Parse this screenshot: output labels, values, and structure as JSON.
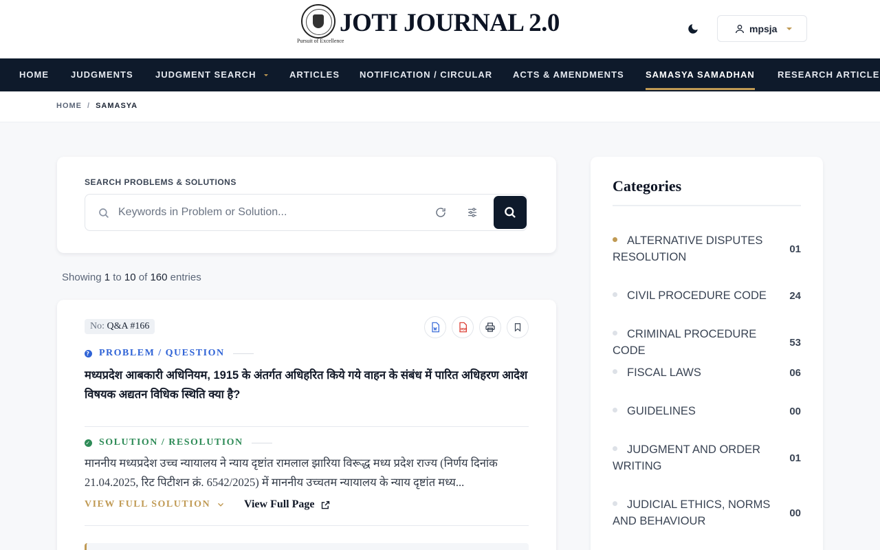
{
  "header": {
    "title": "JOTI JOURNAL 2.0",
    "motto": "Pursuit of Excellence",
    "user": "mpsja",
    "theme_icon": "moon-icon"
  },
  "nav": {
    "items": [
      {
        "label": "HOME"
      },
      {
        "label": "JUDGMENTS"
      },
      {
        "label": "JUDGMENT SEARCH"
      },
      {
        "label": "ARTICLES"
      },
      {
        "label": "NOTIFICATION / CIRCULAR"
      },
      {
        "label": "ACTS & AMENDMENTS"
      },
      {
        "label": "SAMASYA SAMADHAN"
      },
      {
        "label": "RESEARCH ARTICLES"
      }
    ],
    "active": "SAMASYA SAMADHAN"
  },
  "breadcrumb": {
    "home": "HOME",
    "sep": "/",
    "current": "SAMASYA"
  },
  "search": {
    "label": "SEARCH PROBLEMS & SOLUTIONS",
    "placeholder": "Keywords in Problem or Solution...",
    "value": ""
  },
  "entries": {
    "prefix": "Showing",
    "from": "1",
    "to_word": "to",
    "to": "10",
    "of_word": "of",
    "total": "160",
    "suffix": "entries"
  },
  "qa": {
    "no_label": "No:",
    "no_value": "Q&A #166",
    "problem_heading": "PROBLEM / QUESTION",
    "problem_text": "मध्यप्रदेश आबकारी अधिनियम, 1915 के अंतर्गत अधिहरित किये गये वाहन के संबंध में पारित अधिहरण आदेश विषयक अद्यतन विधिक स्थिति क्या है?",
    "solution_heading": "SOLUTION / RESOLUTION",
    "solution_text": "माननीय मध्यप्रदेश उच्च न्यायालय ने न्याय दृष्टांत रामलाल झारिया विरूद्ध मध्य प्रदेश राज्य (निर्णय दिनांक 21.04.2025, रिट पिटीशन क्रं. 6542/2025) में माननीय उच्चतम न्यायालय के न्याय दृष्टांत मध्य...",
    "view_full": "VIEW FULL SOLUTION",
    "view_page": "View Full Page"
  },
  "categories": {
    "title": "Categories",
    "items": [
      {
        "name": "ALTERNATIVE DISPUTES RESOLUTION",
        "count": "01"
      },
      {
        "name": "CIVIL PROCEDURE CODE",
        "count": "24"
      },
      {
        "name": "CRIMINAL PROCEDURE CODE",
        "count": "53"
      },
      {
        "name": "FISCAL LAWS",
        "count": "06"
      },
      {
        "name": "GUIDELINES",
        "count": "00"
      },
      {
        "name": "JUDGMENT AND ORDER WRITING",
        "count": "01"
      },
      {
        "name": "JUDICIAL ETHICS, NORMS AND BEHAVIOUR",
        "count": "00"
      }
    ]
  },
  "colors": {
    "navy": "#0e1a2b",
    "gold": "#c09a54",
    "problem": "#2f63d6",
    "solution": "#2e8b57"
  }
}
